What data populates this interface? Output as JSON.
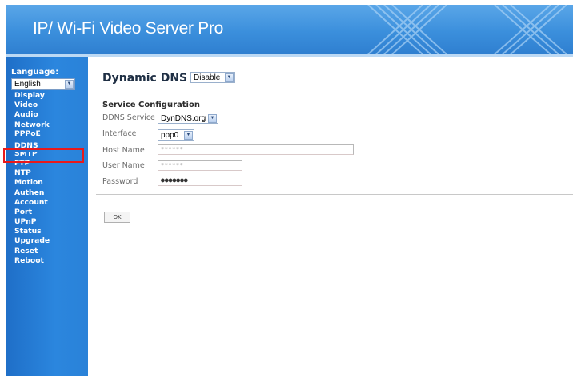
{
  "header": {
    "title": "IP/ Wi-Fi Video Server Pro"
  },
  "sidebar": {
    "language_label": "Language:",
    "language_value": "English",
    "items": [
      "Display",
      "Video",
      "Audio",
      "Network",
      "PPPoE",
      "DDNS",
      "SMTP",
      "FTP",
      "NTP",
      "Motion",
      "Authen",
      "Account",
      "Port",
      "UPnP",
      "Status",
      "Upgrade",
      "Reset",
      "Reboot"
    ],
    "active_item": "DDNS"
  },
  "main": {
    "title": "Dynamic DNS",
    "mode_value": "Disable",
    "section_title": "Service Configuration",
    "ddns_service_label": "DDNS Service",
    "ddns_service_value": "DynDNS.org",
    "interface_label": "Interface",
    "interface_value": "ppp0",
    "host_name_label": "Host Name",
    "host_name_value": "******",
    "user_name_label": "User Name",
    "user_name_value": "******",
    "password_label": "Password",
    "password_value": "●●●●●●●",
    "ok_label": "OK"
  },
  "colors": {
    "header": "#3b8fdc",
    "sidebar": "#2b86de",
    "highlight": "#e8191b"
  },
  "icons": {
    "dropdown": "chevron-down-icon"
  }
}
